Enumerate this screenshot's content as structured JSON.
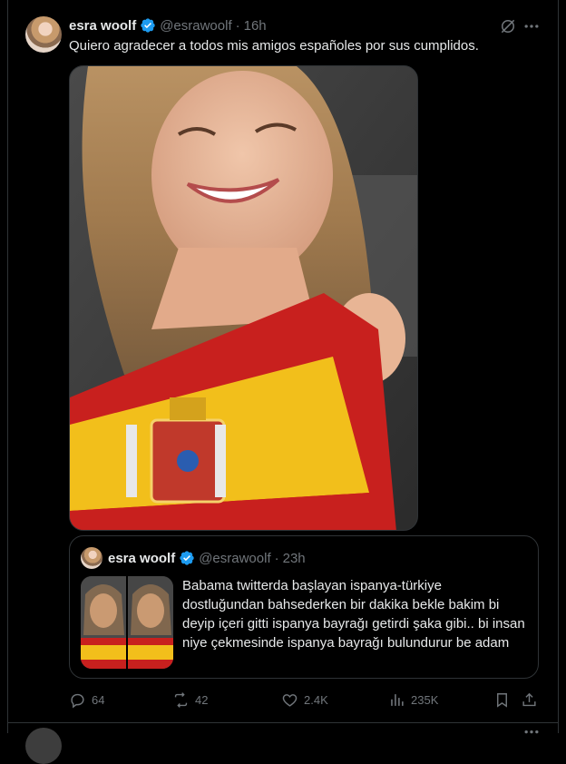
{
  "tweet": {
    "author_name": "esra woolf",
    "handle": "@esrawoolf",
    "separator": "·",
    "time": "16h",
    "text": "Quiero agradecer a todos mis amigos españoles por sus cumplidos."
  },
  "quoted": {
    "author_name": "esra woolf",
    "handle": "@esrawoolf",
    "separator": "·",
    "time": "23h",
    "text": "Babama twitterda başlayan ispanya-türkiye dostluğundan bahsederken bir dakika bekle bakim bi deyip içeri gitti ispanya bayrağı getirdi şaka gibi.. bi insan niye çekmesinde ispanya bayrağı bulundurur be adam"
  },
  "actions": {
    "replies": "64",
    "reposts": "42",
    "likes": "2.4K",
    "views": "235K"
  },
  "icons": {
    "verified": "verified-badge-icon",
    "grok": "grok-icon",
    "more": "more-icon",
    "reply": "reply-icon",
    "repost": "repost-icon",
    "like": "heart-icon",
    "views": "analytics-icon",
    "bookmark": "bookmark-icon",
    "share": "share-icon"
  },
  "colors": {
    "background": "#000000",
    "text": "#e7e9ea",
    "muted": "#71767b",
    "border": "#2f3336",
    "verified": "#1d9bf0"
  }
}
